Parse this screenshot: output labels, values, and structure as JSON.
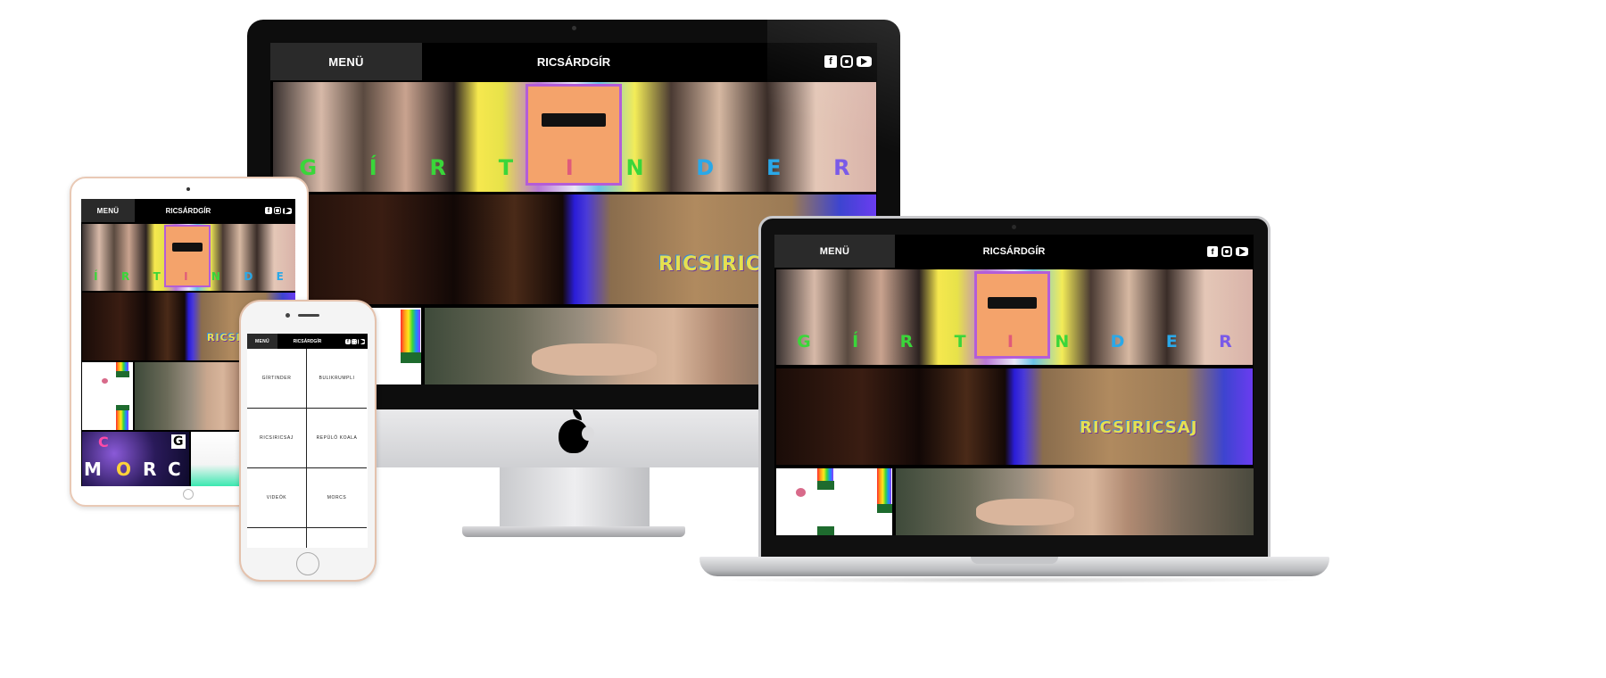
{
  "site": {
    "menu_label": "MENÜ",
    "brand": "RICSÁRDGÍR",
    "social_icons": [
      "facebook-icon",
      "instagram-icon",
      "youtube-icon"
    ],
    "social_glyphs": {
      "facebook": "f"
    }
  },
  "tiles": {
    "girtinder_letters": [
      "G",
      "Í",
      "R",
      "T",
      "I",
      "N",
      "D",
      "E",
      "R"
    ],
    "ricsiricsaj_word": "RICSIRICSAJ",
    "morcs_letters": [
      "C",
      "G",
      "M",
      "O",
      "R",
      "C"
    ]
  },
  "mobile_menu": {
    "items": [
      "GÍRTINDER",
      "BULIKRUMPLI",
      "RICSIRICSAJ",
      "REPÜLŐ KOALA",
      "VIDEÓK",
      "MORCS"
    ]
  },
  "colors": {
    "header_bg": "#000000",
    "menu_tab_bg": "#2a2a2a",
    "nav_text": "#ffffff",
    "ricsiricsaj_text": "#e5e050"
  }
}
